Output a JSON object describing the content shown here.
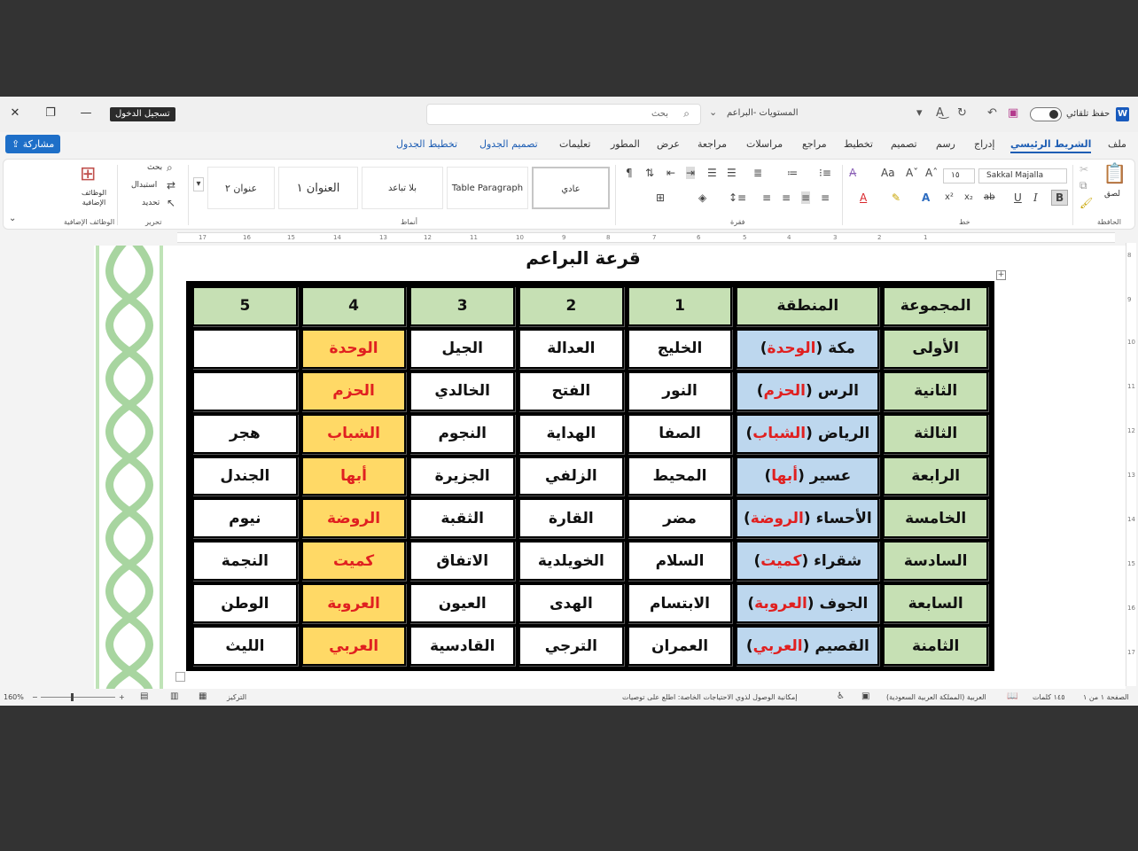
{
  "titlebar": {
    "signin": "تسجيل الدخول",
    "search_label": "بحث",
    "doc_title": "المستويات -البراعم",
    "autosave": "حفظ تلقائي",
    "word_icon": "W",
    "close": "✕",
    "restore": "❐",
    "minimize": "—"
  },
  "menu": {
    "share": "مشاركة",
    "tabs": [
      "ملف",
      "الشريط الرئيسي",
      "إدراج",
      "رسم",
      "تصميم",
      "تخطيط",
      "مراجع",
      "مراسلات",
      "مراجعة",
      "عرض",
      "المطور",
      "تعليمات",
      "تصميم الجدول",
      "تخطيط الجدول"
    ]
  },
  "ribbon": {
    "clipboard": {
      "paste": "لصق",
      "group": "الحافظة"
    },
    "font": {
      "name": "Sakkal Majalla",
      "size": "١٥",
      "group": "خط",
      "bold": "B",
      "italic": "I",
      "underline": "U"
    },
    "paragraph": {
      "group": "فقرة"
    },
    "styles": {
      "items": [
        "عادي",
        "Table Paragraph",
        "بلا تباعد",
        "العنوان ١",
        "عنوان ٢"
      ],
      "group": "أنماط"
    },
    "editing": {
      "find": "بحث",
      "replace": "استبدال",
      "select": "تحديد",
      "group": "تحرير"
    },
    "addins": {
      "label": "الوظائف الإضافية",
      "group": "الوظائف الإضافية"
    }
  },
  "document": {
    "heading": "قرعة البراعم",
    "headers": [
      "المجموعة",
      "المنطقة",
      "1",
      "2",
      "3",
      "4",
      "5"
    ],
    "rows": [
      {
        "group": "الأولى",
        "region": "مكة (",
        "region_team": "الوحدة",
        "region_close": ")",
        "c1": "الخليج",
        "c2": "العدالة",
        "c3": "الجيل",
        "c4": "الوحدة",
        "c5": ""
      },
      {
        "group": "الثانية",
        "region": "الرس (",
        "region_team": "الحزم",
        "region_close": ")",
        "c1": "النور",
        "c2": "الفتح",
        "c3": "الخالدي",
        "c4": "الحزم",
        "c5": ""
      },
      {
        "group": "الثالثة",
        "region": "الرياض (",
        "region_team": "الشباب",
        "region_close": ")",
        "c1": "الصفا",
        "c2": "الهداية",
        "c3": "النجوم",
        "c4": "الشباب",
        "c5": "هجر"
      },
      {
        "group": "الرابعة",
        "region": "عسير (",
        "region_team": "أبها",
        "region_close": ")",
        "c1": "المحيط",
        "c2": "الزلفي",
        "c3": "الجزيرة",
        "c4": "أبها",
        "c5": "الجندل"
      },
      {
        "group": "الخامسة",
        "region": "الأحساء (",
        "region_team": "الروضة",
        "region_close": ")",
        "c1": "مضر",
        "c2": "القارة",
        "c3": "الثقبة",
        "c4": "الروضة",
        "c5": "نيوم"
      },
      {
        "group": "السادسة",
        "region": "شقراء (",
        "region_team": "كميت",
        "region_close": ")",
        "c1": "السلام",
        "c2": "الخويلدية",
        "c3": "الاتفاق",
        "c4": "كميت",
        "c5": "النجمة"
      },
      {
        "group": "السابعة",
        "region": "الجوف (",
        "region_team": "العروبة",
        "region_close": ")",
        "c1": "الابتسام",
        "c2": "الهدى",
        "c3": "العيون",
        "c4": "العروبة",
        "c5": "الوطن"
      },
      {
        "group": "الثامنة",
        "region": "القصيم (",
        "region_team": "العربي",
        "region_close": ")",
        "c1": "العمران",
        "c2": "الترجي",
        "c3": "القادسية",
        "c4": "العربي",
        "c5": "الليث"
      }
    ]
  },
  "statusbar": {
    "page": "الصفحة ١ من ١",
    "words": "١٤٥ كلمات",
    "language": "العربية (المملكة العربية السعودية)",
    "accessibility": "إمكانية الوصول لذوي الاحتياجات الخاصة: اطلع على توصيات",
    "focus": "التركيز",
    "zoom": "160%"
  },
  "colors": {
    "header_green": "#c6e0b4",
    "region_blue": "#bdd7ee",
    "host_yellow": "#ffd966",
    "host_red": "#e02020",
    "accent": "#1e5eb4"
  }
}
